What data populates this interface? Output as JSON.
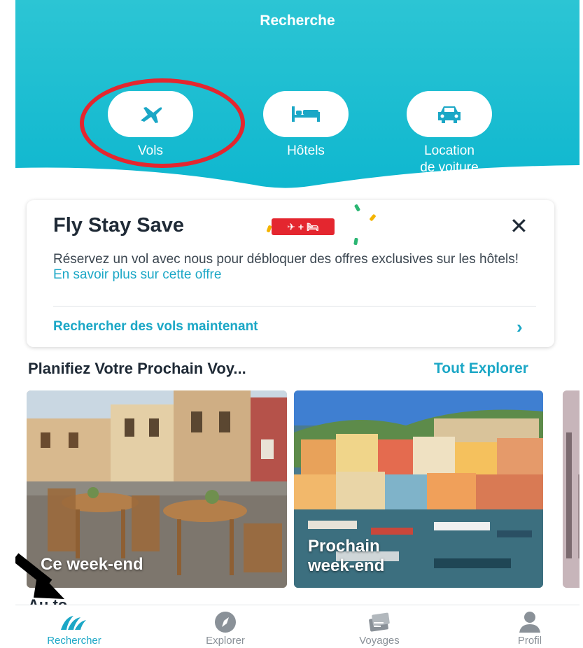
{
  "header": {
    "title": "Recherche",
    "categories": [
      {
        "label": "Vols",
        "icon": "airplane-icon"
      },
      {
        "label": "Hôtels",
        "icon": "bed-icon"
      },
      {
        "label": "Location",
        "label2": "de voiture",
        "icon": "car-icon"
      }
    ]
  },
  "promo": {
    "title": "Fly Stay Save",
    "badge": "✈ + 🛏",
    "body": "Réservez un vol avec nous pour débloquer des offres exclusives sur les hôtels! ",
    "link": "En savoir plus sur cette offre",
    "cta": "Rechercher des vols maintenant",
    "close_icon": "close-icon",
    "cta_icon": "chevron-right-icon"
  },
  "section": {
    "title": "Planifiez Votre Prochain Voy...",
    "explore_link": "Tout Explorer",
    "cards": [
      {
        "label": "Ce week-end"
      },
      {
        "label": "Prochain",
        "label2": "week-end"
      }
    ],
    "next_section_peek": "Au to... ..."
  },
  "tabbar": {
    "items": [
      {
        "label": "Rechercher",
        "icon": "search-wave-icon",
        "active": true
      },
      {
        "label": "Explorer",
        "icon": "compass-icon"
      },
      {
        "label": "Voyages",
        "icon": "tickets-icon"
      },
      {
        "label": "Profil",
        "icon": "user-icon"
      }
    ]
  },
  "colors": {
    "accent": "#1ba7c6",
    "header_gradient_top": "#2cc5d4",
    "header_gradient_bottom": "#0fb7cf",
    "highlight_ring": "#e4262f",
    "badge": "#e4262f"
  }
}
